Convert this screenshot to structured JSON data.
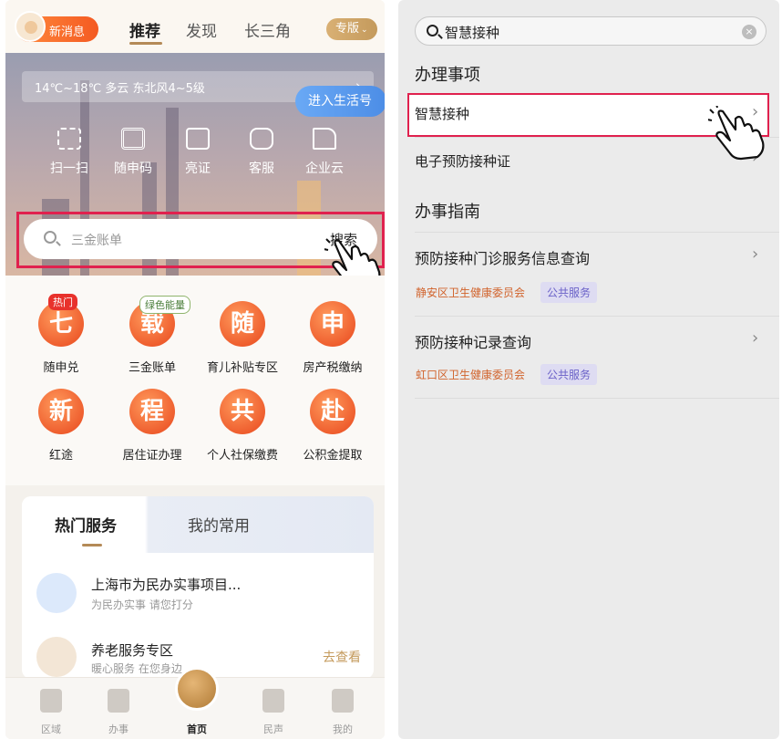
{
  "left": {
    "topnav": {
      "message_badge": "新消息",
      "tabs": [
        "推荐",
        "发现",
        "长三角"
      ],
      "active_tab": "推荐",
      "version_button": "专版"
    },
    "weather": {
      "text": "14℃~18℃ 多云 东北风4~5级",
      "arrow": "›"
    },
    "quick_actions": [
      {
        "label": "扫一扫",
        "icon": "scan-icon"
      },
      {
        "label": "随申码",
        "icon": "qr-code-icon"
      },
      {
        "label": "亮证",
        "icon": "card-icon"
      },
      {
        "label": "客服",
        "icon": "customer-service-icon"
      },
      {
        "label": "企业云",
        "icon": "building-icon"
      }
    ],
    "search": {
      "placeholder": "三金账单",
      "button": "搜索"
    },
    "services": [
      {
        "glyph": "七",
        "label": "随申兑",
        "badge": "热门"
      },
      {
        "glyph": "载",
        "label": "三金账单",
        "badge": "绿色能量"
      },
      {
        "glyph": "随",
        "label": "育儿补贴专区",
        "badge": ""
      },
      {
        "glyph": "申",
        "label": "房产税缴纳",
        "badge": ""
      },
      {
        "glyph": "新",
        "label": "红途",
        "badge": ""
      },
      {
        "glyph": "程",
        "label": "居住证办理",
        "badge": ""
      },
      {
        "glyph": "共",
        "label": "个人社保缴费",
        "badge": ""
      },
      {
        "glyph": "赴",
        "label": "公积金提取",
        "badge": ""
      }
    ],
    "card": {
      "tabs": [
        "热门服务",
        "我的常用"
      ],
      "rows": [
        {
          "title": "上海市为民办实事项目...",
          "subtitle": "为民办实事 请您打分",
          "action": "进入生活号"
        },
        {
          "title": "养老服务专区",
          "subtitle": "暖心服务 在您身边",
          "action": "去查看"
        }
      ]
    },
    "bottom_nav": [
      "区域",
      "办事",
      "首页",
      "民声",
      "我的"
    ],
    "colors": {
      "accent": "#b48a57",
      "highlight": "#e0214e",
      "orange": "#e8461c"
    }
  },
  "right": {
    "search": {
      "query": "智慧接种",
      "clear": "×"
    },
    "sections": [
      {
        "heading": "办理事项",
        "items": [
          {
            "title": "智慧接种",
            "chevron": "›",
            "tags": []
          },
          {
            "title": "电子预防接种证",
            "chevron": "›",
            "tags": []
          }
        ]
      },
      {
        "heading": "办事指南",
        "items": [
          {
            "title": "预防接种门诊服务信息查询",
            "chevron": "›",
            "tags": [
              "静安区卫生健康委员会",
              "公共服务"
            ]
          },
          {
            "title": "预防接种记录查询",
            "chevron": "›",
            "tags": [
              "虹口区卫生健康委员会",
              "公共服务"
            ]
          }
        ]
      }
    ]
  }
}
